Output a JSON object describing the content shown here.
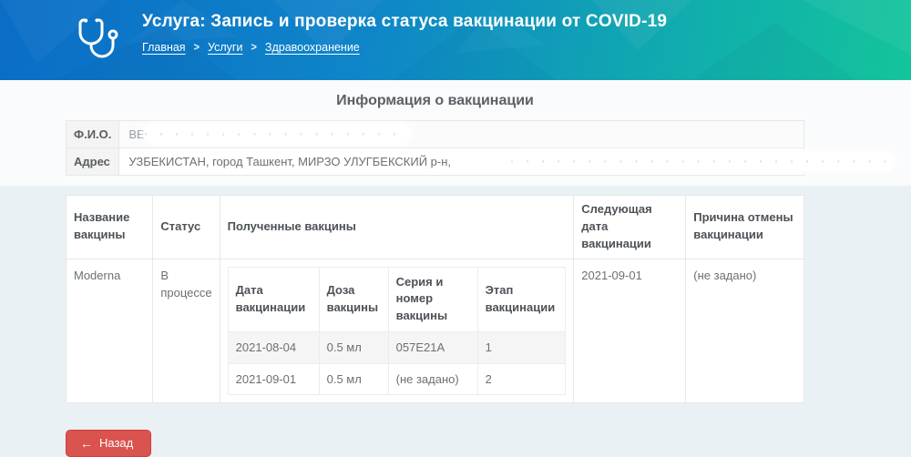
{
  "header": {
    "title": "Услуга: Запись и проверка статуса вакцинации от COVID-19",
    "icon": "stethoscope-icon",
    "breadcrumbs": [
      {
        "label": "Главная"
      },
      {
        "label": "Услуги"
      },
      {
        "label": "Здравоохранение"
      }
    ],
    "separator": ">",
    "gradient_from": "#0a6dc6",
    "gradient_to": "#14c49b"
  },
  "section_title": "Информация о вакцинации",
  "person_info": {
    "fio_label": "Ф.И.О.",
    "fio_value_visible": "ВЕ",
    "fio_value_redacted": true,
    "address_label": "Адрес",
    "address_value_visible": "УЗБЕКИСТАН, город Ташкент, МИРЗО УЛУГБЕКСКИЙ р-н,",
    "address_value_redacted": true
  },
  "vaccination_table": {
    "columns": [
      "Название вакцины",
      "Статус",
      "Полученные вакцины",
      "Следующая дата вакцинации",
      "Причина отмены вакцинации"
    ],
    "rows": [
      {
        "vaccine_name": "Moderna",
        "status": "В процессе",
        "received": {
          "columns": [
            "Дата вакцинации",
            "Доза вакцины",
            "Серия и номер вакцины",
            "Этап вакцинации"
          ],
          "rows": [
            [
              "2021-08-04",
              "0.5 мл",
              "057E21A",
              "1"
            ],
            [
              "2021-09-01",
              "0.5 мл",
              "(не задано)",
              "2"
            ]
          ]
        },
        "next_date": "2021-09-01",
        "cancel_reason": "(не задано)"
      }
    ]
  },
  "back_button": {
    "label": "Назад",
    "color": "#d9534f"
  }
}
